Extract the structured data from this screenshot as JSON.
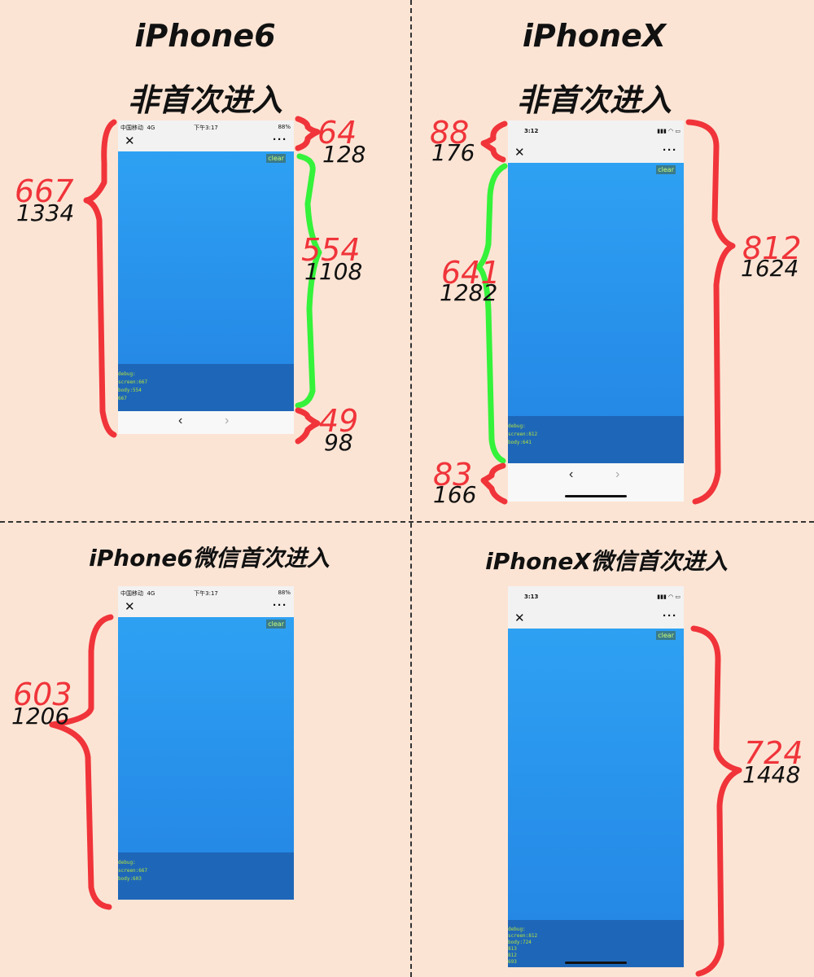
{
  "headings": {
    "tl_device": "iPhone6",
    "tl_mode": "非首次进入",
    "tr_device": "iPhoneX",
    "tr_mode": "非首次进入",
    "bl_title": "iPhone6微信首次进入",
    "br_title": "iPhoneX微信首次进入"
  },
  "iphone6_status": {
    "carrier": "中国移动",
    "network": "4G",
    "time": "下午3:17",
    "battery": "88%"
  },
  "iphonex_status_1": {
    "time": "3:12"
  },
  "iphonex_status_2": {
    "time": "3:13"
  },
  "ui": {
    "close_glyph": "✕",
    "more_glyph": "···",
    "clear_label": "clear",
    "back_glyph": "‹",
    "forward_glyph": "›"
  },
  "debug": {
    "tl": "debug:\nscreen:667\nbody:554\n667",
    "tr": "debug:\nscreen:812\nbody:641",
    "bl": "debug:\nscreen:667\nbody:603",
    "br": "debug:\nscreen:812\nbody:724\n813\n812\n693"
  },
  "annotations": {
    "tl_total_pt": "667",
    "tl_total_px": "1334",
    "tl_top_pt": "64",
    "tl_top_px": "128",
    "tl_body_pt": "554",
    "tl_body_px": "1108",
    "tl_bottom_pt": "49",
    "tl_bottom_px": "98",
    "tr_top_pt": "88",
    "tr_top_px": "176",
    "tr_body_pt": "641",
    "tr_body_px": "1282",
    "tr_bottom_pt": "83",
    "tr_bottom_px": "166",
    "tr_total_pt": "812",
    "tr_total_px": "1624",
    "bl_body_pt": "603",
    "bl_body_px": "1206",
    "br_body_pt": "724",
    "br_body_px": "1448"
  },
  "colors": {
    "background": "#fce4d4",
    "content_gradient_top": "#2ea1f3",
    "content_gradient_bottom": "#2384e3",
    "debug_panel": "#1e67b8",
    "debug_text": "#b6e33c",
    "red_brace": "#f0343a",
    "green_brace": "#35f23a"
  }
}
